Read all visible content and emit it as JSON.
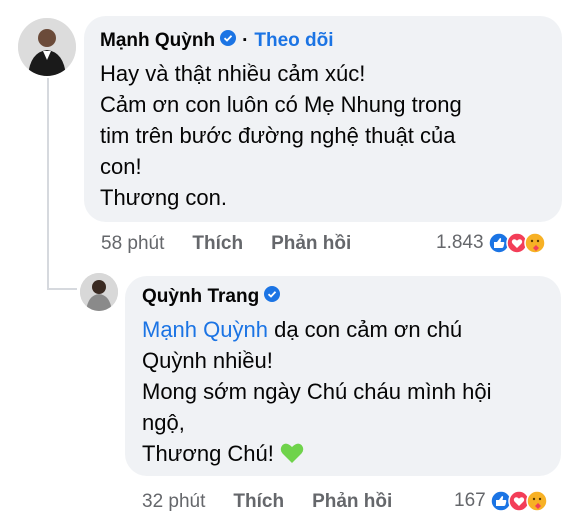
{
  "comment": {
    "author": "Mạnh Quỳnh",
    "follow_label": "Theo dõi",
    "separator": "·",
    "lines": [
      "Hay và thật nhiều cảm xúc!",
      "Cảm ơn con luôn có Mẹ Nhung trong",
      "tim trên bước đường nghệ thuật của",
      "con!",
      "Thương con."
    ],
    "time": "58 phút",
    "like_label": "Thích",
    "reply_label": "Phản hồi",
    "reaction_count": "1.843"
  },
  "reply": {
    "author": "Quỳnh Trang",
    "mention": "Mạnh Quỳnh",
    "line1_rest": " dạ con cảm ơn chú",
    "lines": [
      "Quỳnh nhiều!",
      "Mong sớm ngày Chú cháu mình hội",
      "ngộ,"
    ],
    "last_line": "Thương Chú! ",
    "time": "32 phút",
    "like_label": "Thích",
    "reply_label": "Phản hồi",
    "reaction_count": "167"
  },
  "colors": {
    "link_blue": "#1b74e4",
    "bubble_bg": "#f0f2f5",
    "meta_gray": "#65676b"
  }
}
